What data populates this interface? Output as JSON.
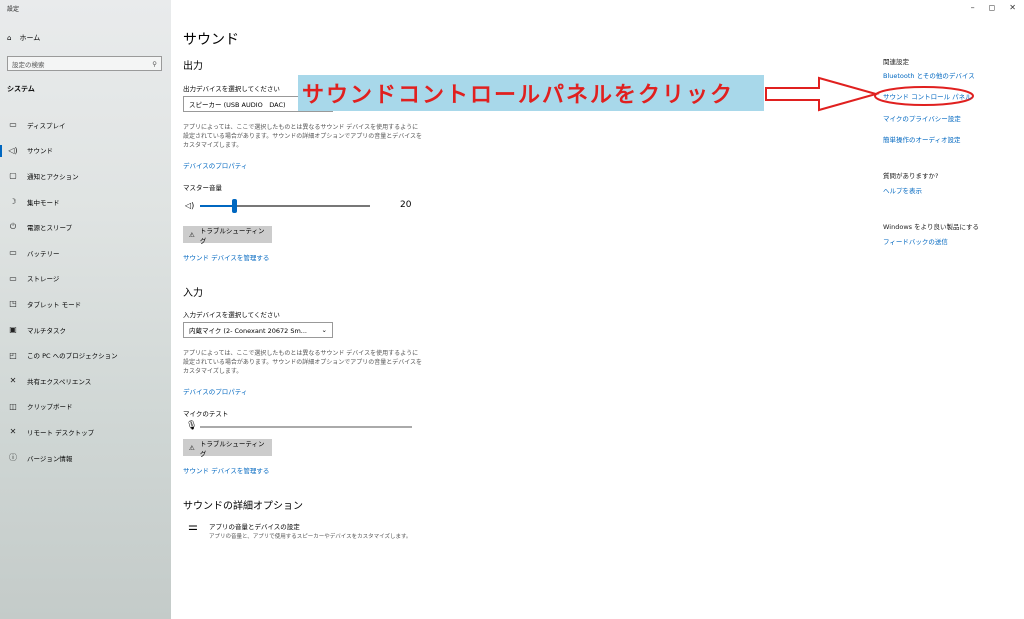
{
  "window": {
    "title": "設定",
    "minimize": "–",
    "maximize": "◻",
    "close": "✕"
  },
  "sidebar": {
    "home": "ホーム",
    "search_placeholder": "設定の検索",
    "section": "システム",
    "items": [
      {
        "label": "ディスプレイ",
        "icon": "monitor-icon",
        "glyph": "▭"
      },
      {
        "label": "サウンド",
        "icon": "speaker-icon",
        "glyph": "◁)"
      },
      {
        "label": "通知とアクション",
        "icon": "notification-icon",
        "glyph": "▢"
      },
      {
        "label": "集中モード",
        "icon": "moon-icon",
        "glyph": "☽"
      },
      {
        "label": "電源とスリープ",
        "icon": "power-icon",
        "glyph": "⏻"
      },
      {
        "label": "バッテリー",
        "icon": "battery-icon",
        "glyph": "▭"
      },
      {
        "label": "ストレージ",
        "icon": "storage-icon",
        "glyph": "▭"
      },
      {
        "label": "タブレット モード",
        "icon": "tablet-icon",
        "glyph": "◳"
      },
      {
        "label": "マルチタスク",
        "icon": "multitask-icon",
        "glyph": "▣"
      },
      {
        "label": "この PC へのプロジェクション",
        "icon": "projection-icon",
        "glyph": "◰"
      },
      {
        "label": "共有エクスペリエンス",
        "icon": "share-icon",
        "glyph": "✕"
      },
      {
        "label": "クリップボード",
        "icon": "clipboard-icon",
        "glyph": "◫"
      },
      {
        "label": "リモート デスクトップ",
        "icon": "remote-icon",
        "glyph": "✕"
      },
      {
        "label": "バージョン情報",
        "icon": "info-icon",
        "glyph": "ⓘ"
      }
    ]
  },
  "main": {
    "title": "サウンド",
    "output": {
      "heading": "出力",
      "select_label": "出力デバイスを選択してください",
      "device": "スピーカー (USB AUDIO　DAC)",
      "desc": "アプリによっては、ここで選択したものとは異なるサウンド デバイスを使用するように設定されている場合があります。サウンドの詳細オプションでアプリの音量とデバイスをカスタマイズします。",
      "properties_link": "デバイスのプロパティ",
      "master_label": "マスター音量",
      "volume": "20",
      "volume_fraction": 0.2,
      "troubleshoot": "トラブルシューティング",
      "manage_link": "サウンド デバイスを管理する"
    },
    "input": {
      "heading": "入力",
      "select_label": "入力デバイスを選択してください",
      "device": "内蔵マイク (2- Conexant 20672 Sm...",
      "desc": "アプリによっては、ここで選択したものとは異なるサウンド デバイスを使用するように設定されている場合があります。サウンドの詳細オプションでアプリの音量とデバイスをカスタマイズします。",
      "properties_link": "デバイスのプロパティ",
      "mic_test_label": "マイクのテスト",
      "troubleshoot": "トラブルシューティング",
      "manage_link": "サウンド デバイスを管理する"
    },
    "advanced": {
      "heading": "サウンドの詳細オプション",
      "item_title": "アプリの音量とデバイスの設定",
      "item_desc": "アプリの音量と、アプリで使用するスピーカーやデバイスをカスタマイズします。"
    }
  },
  "annotation": {
    "text": "サウンドコントロールパネルをクリック",
    "banner_color": "#a8d8ea",
    "text_color": "#e0201f"
  },
  "related": {
    "heading": "関連設定",
    "links": [
      "Bluetooth とその他のデバイス",
      "サウンド コントロール パネル",
      "マイクのプライバシー設定",
      "簡単操作のオーディオ設定"
    ],
    "question": "質問がありますか?",
    "help": "ヘルプを表示",
    "improve": "Windows をより良い製品にする",
    "feedback": "フィードバックの送信"
  }
}
